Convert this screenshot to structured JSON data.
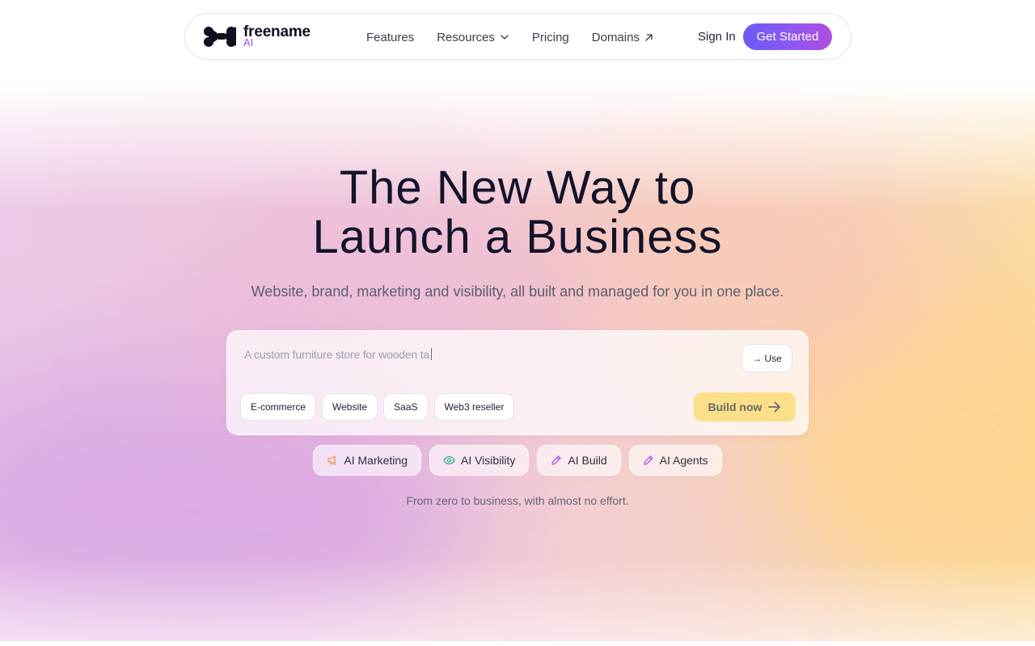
{
  "brand": {
    "name": "freename",
    "suffix": "AI"
  },
  "nav": {
    "links": [
      {
        "label": "Features"
      },
      {
        "label": "Resources",
        "icon": "chevron-down-icon"
      },
      {
        "label": "Pricing"
      },
      {
        "label": "Domains",
        "icon": "arrow-up-right-icon"
      }
    ],
    "sign_in": "Sign In",
    "cta": "Get Started"
  },
  "hero": {
    "title_line1": "The New Way to",
    "title_line2": "Launch a Business",
    "subtitle": "Website, brand, marketing and visibility, all built and managed for you in one place."
  },
  "prompt": {
    "text": "A custom furniture store for wooden ta",
    "use_label": "→ Use",
    "chips": [
      "E-commerce",
      "Website",
      "SaaS",
      "Web3 reseller"
    ],
    "build_label": "Build now"
  },
  "features": [
    {
      "label": "AI Marketing",
      "icon": "megaphone-icon",
      "color": "#f0924a"
    },
    {
      "label": "AI Visibility",
      "icon": "eye-icon",
      "color": "#2fb38a"
    },
    {
      "label": "AI Build",
      "icon": "pencil-icon",
      "color": "#a45ce8"
    },
    {
      "label": "AI Agents",
      "icon": "pencil-icon",
      "color": "#a45ce8"
    }
  ],
  "tagline": "From zero to business, with almost no effort.",
  "colors": {
    "accent_start": "#6a5cf6",
    "accent_end": "#b14de2",
    "build": "#fbe089",
    "brand_ai": "#a24ce0"
  }
}
